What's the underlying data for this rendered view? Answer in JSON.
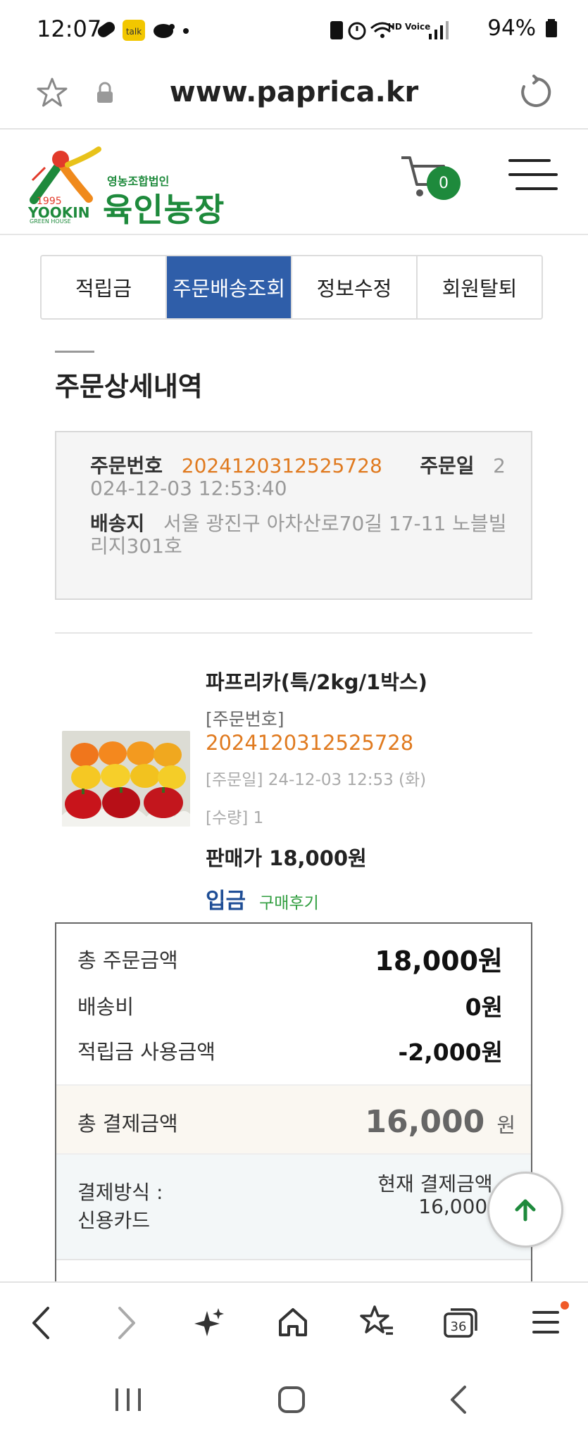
{
  "status_bar": {
    "time": "12:07",
    "battery": "94%",
    "network_label": "HD Voice"
  },
  "browser": {
    "url": "www.paprica.kr"
  },
  "header": {
    "logo_year": "1995",
    "logo_brand_en": "YOOKIN",
    "logo_brand_sub": "GREEN HOUSE",
    "logo_corp": "영농조합법인",
    "logo_name": "육인농장",
    "cart_count": "0"
  },
  "tabs": [
    {
      "label": "적립금"
    },
    {
      "label": "주문배송조회"
    },
    {
      "label": "정보수정"
    },
    {
      "label": "회원탈퇴"
    }
  ],
  "section_title": "주문상세내역",
  "order_info": {
    "order_no_label": "주문번호",
    "order_no": "2024120312525728",
    "order_date_label": "주문일",
    "order_date": "2024-12-03 12:53:40",
    "address_label": "배송지",
    "address": "서울 광진구 아차산로70길 17-11 노블빌리지301호"
  },
  "product": {
    "name": "파프리카(특/2kg/1박스)",
    "order_no_label": "[주문번호]",
    "order_no": "2024120312525728",
    "order_date": "[주문일] 24-12-03 12:53 (화)",
    "quantity": "[수량] 1",
    "price": "판매가 18,000원",
    "status": "입금",
    "review_link": "구매후기"
  },
  "summary": {
    "total_order_label": "총 주문금액",
    "total_order_value": "18,000원",
    "shipping_label": "배송비",
    "shipping_value": "0원",
    "points_label": "적립금 사용금액",
    "points_value": "-2,000원",
    "total_pay_label": "총 결제금액",
    "total_pay_value": "16,000",
    "total_pay_unit": "원",
    "method_label": "결제방식 :",
    "method_value": "신용카드",
    "current_pay_label": "현재 결제금액 :",
    "current_pay_value": "16,000원"
  },
  "colors": {
    "tab_active": "#2f5ea9",
    "orange": "#e07a1f",
    "status_blue": "#1f4e96",
    "review_green": "#2f9d3e",
    "logo_green": "#1e8a3c"
  }
}
